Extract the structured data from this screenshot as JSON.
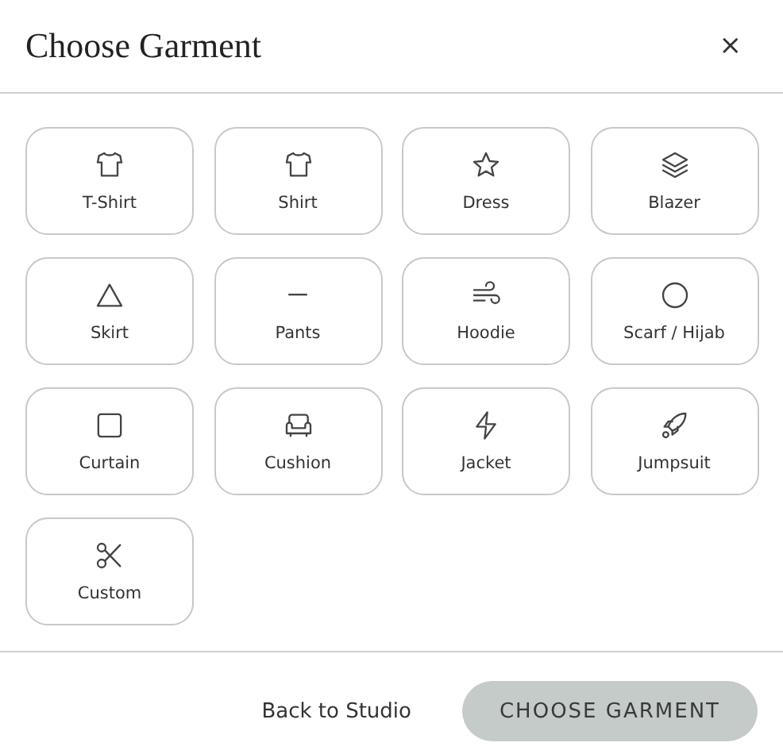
{
  "dialog": {
    "title": "Choose Garment",
    "close": "×"
  },
  "garments": [
    {
      "label": "T-Shirt",
      "kind": "shirt"
    },
    {
      "label": "Shirt",
      "kind": "shirt"
    },
    {
      "label": "Dress",
      "kind": "star"
    },
    {
      "label": "Blazer",
      "kind": "layers"
    },
    {
      "label": "Skirt",
      "kind": "triangle"
    },
    {
      "label": "Pants",
      "kind": "minus"
    },
    {
      "label": "Hoodie",
      "kind": "wind"
    },
    {
      "label": "Scarf / Hijab",
      "kind": "circle"
    },
    {
      "label": "Curtain",
      "kind": "square"
    },
    {
      "label": "Cushion",
      "kind": "sofa"
    },
    {
      "label": "Jacket",
      "kind": "bolt"
    },
    {
      "label": "Jumpsuit",
      "kind": "rocket"
    },
    {
      "label": "Custom",
      "kind": "scissors"
    }
  ],
  "footer": {
    "back": "Back to Studio",
    "confirm": {
      "label": "CHOOSE GARMENT",
      "disabled": true
    }
  }
}
